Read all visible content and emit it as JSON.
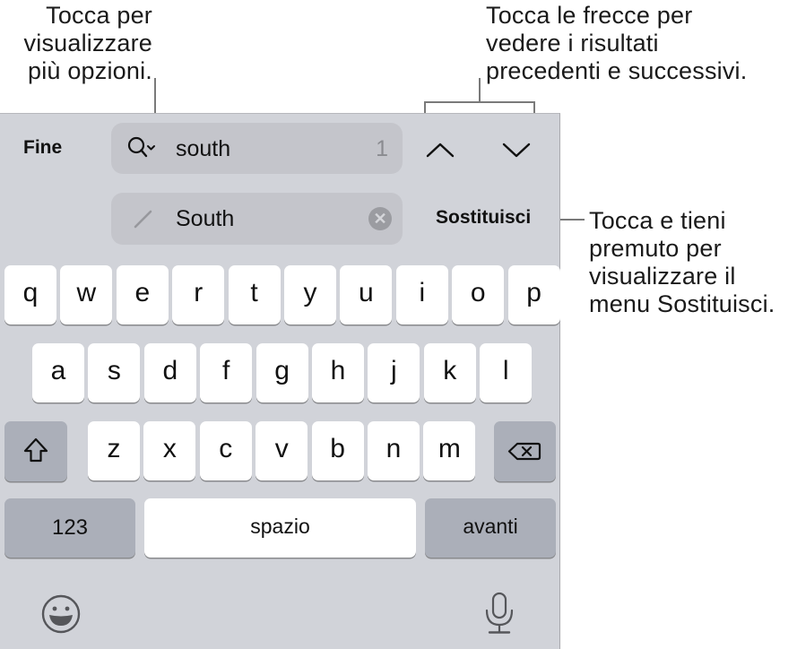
{
  "callouts": {
    "options": "Tocca per\nvisualizzare\npiù opzioni.",
    "arrows": "Tocca le frecce per\nvedere i risultati\nprecedenti e successivi.",
    "replace": "Tocca e tieni\npremuto per\nvisualizzare il\nmenu Sostituisci."
  },
  "toolbar": {
    "done_label": "Fine",
    "find": {
      "value": "south",
      "match_count": "1",
      "icon": "search-options-icon"
    },
    "replace": {
      "value": "South",
      "icon": "pencil-icon",
      "clear_icon": "clear-icon"
    },
    "prev_icon": "chevron-up-icon",
    "next_icon": "chevron-down-icon",
    "replace_label": "Sostituisci"
  },
  "keyboard": {
    "row1": [
      "q",
      "w",
      "e",
      "r",
      "t",
      "y",
      "u",
      "i",
      "o",
      "p"
    ],
    "row2": [
      "a",
      "s",
      "d",
      "f",
      "g",
      "h",
      "j",
      "k",
      "l"
    ],
    "row3": [
      "z",
      "x",
      "c",
      "v",
      "b",
      "n",
      "m"
    ],
    "shift_icon": "shift-icon",
    "delete_icon": "delete-icon",
    "numbers_label": "123",
    "space_label": "spazio",
    "return_label": "avanti",
    "emoji_icon": "emoji-icon",
    "mic_icon": "microphone-icon"
  },
  "colors": {
    "keyboard_bg": "#d1d3d9",
    "key_bg": "#ffffff",
    "function_key_bg": "#abafb9",
    "field_bg": "#c4c5cb"
  }
}
